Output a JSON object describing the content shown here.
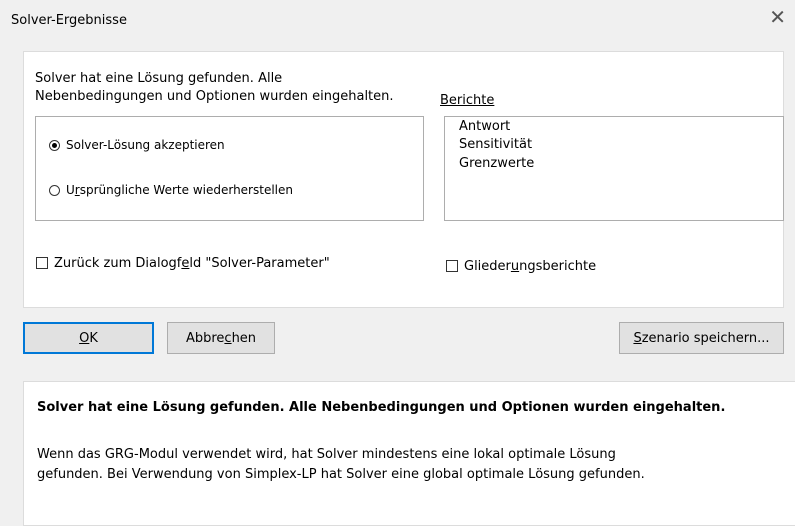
{
  "window": {
    "title": "Solver-Ergebnisse",
    "close_glyph": "✕"
  },
  "message": {
    "line1": "Solver hat eine Lösung gefunden. Alle",
    "line2": "Nebenbedingungen und Optionen wurden eingehalten."
  },
  "reports": {
    "label": "Berichte",
    "items": [
      "Antwort",
      "Sensitivität",
      "Grenzwerte"
    ]
  },
  "options": {
    "keep_label_pre": "Solver-Lösung akzeptieren",
    "restore_label_pre": "U",
    "restore_label_u": "r",
    "restore_label_post": "sprüngliche Werte wiederherstellen",
    "selected": "keep"
  },
  "checkboxes": {
    "return_pre": "Zurück zum Dialogf",
    "return_u": "e",
    "return_post": "ld \"Solver-Parameter\"",
    "return_checked": false,
    "outline_pre": "Glieder",
    "outline_u": "u",
    "outline_post": "ngsberichte",
    "outline_checked": false
  },
  "buttons": {
    "ok_u": "O",
    "ok_post": "K",
    "cancel_pre": "Abbre",
    "cancel_u": "c",
    "cancel_post": "hen",
    "save_u": "S",
    "save_post": "zenario speichern..."
  },
  "info": {
    "heading": "Solver hat eine Lösung gefunden. Alle Nebenbedingungen und Optionen wurden eingehalten.",
    "line1": "Wenn das GRG-Modul verwendet wird, hat Solver mindestens eine lokal optimale Lösung",
    "line2": "gefunden. Bei Verwendung von Simplex-LP hat Solver eine global optimale Lösung gefunden."
  }
}
